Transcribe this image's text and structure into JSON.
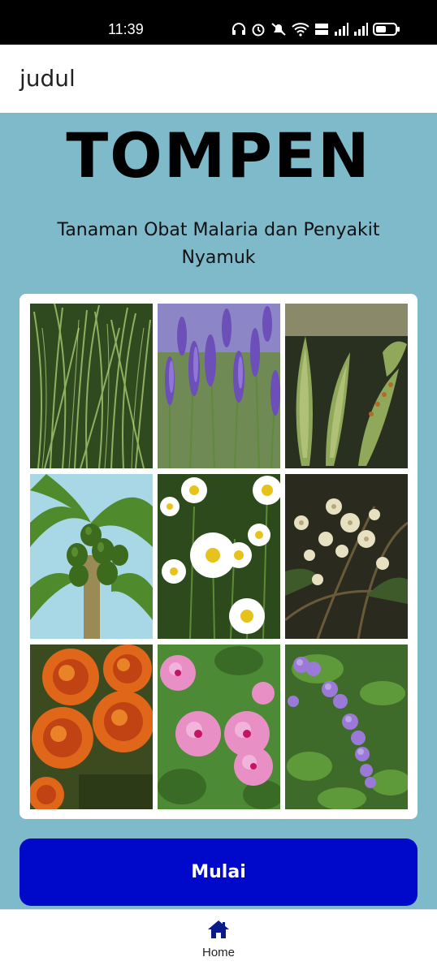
{
  "status_bar": {
    "time": "11:39",
    "icons": [
      "headphones-icon",
      "alarm-icon",
      "mute-icon",
      "wifi-icon",
      "volte-icon",
      "signal-icon",
      "signal-icon",
      "battery-icon"
    ]
  },
  "app_bar": {
    "title": "judul"
  },
  "hero": {
    "title": "TOMPEN",
    "subtitle": "Tanaman Obat Malaria dan Penyakit Nyamuk"
  },
  "gallery": {
    "images": [
      "lemongrass-image",
      "lavender-image",
      "leaf-image",
      "papaya-image",
      "chamomile-image",
      "flowering-branch-image",
      "marigold-image",
      "periwinkle-image",
      "duranta-image"
    ]
  },
  "actions": {
    "start_label": "Mulai"
  },
  "bottom_nav": {
    "home_label": "Home"
  },
  "colors": {
    "background": "#7fbacb",
    "button": "#0009c9",
    "nav_icon": "#0a1a8a"
  }
}
